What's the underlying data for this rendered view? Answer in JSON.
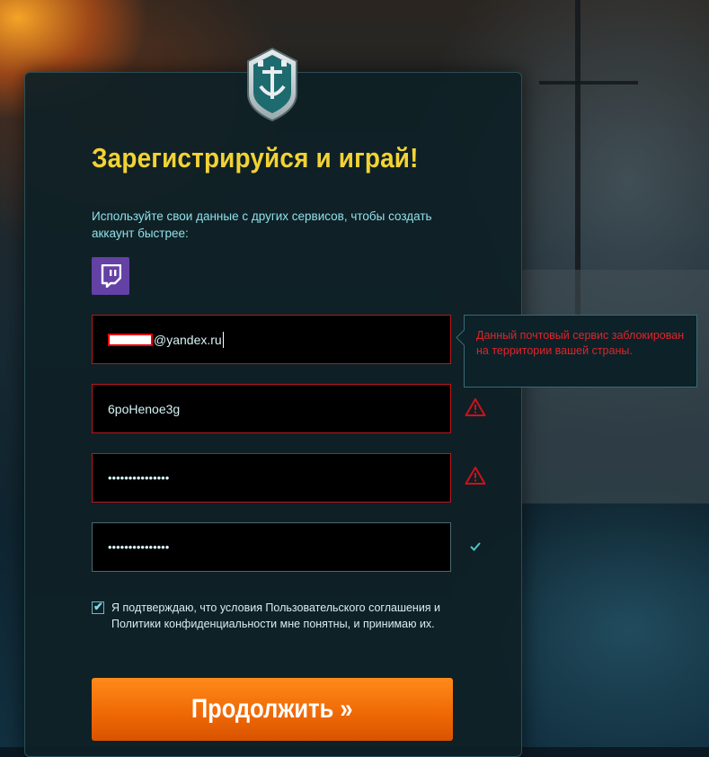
{
  "header": {
    "title": "Зарегистрируйся и играй!",
    "social_hint": "Используйте свои данные с других сервисов, чтобы создать аккаунт быстрее:"
  },
  "social": [
    {
      "name": "twitch",
      "icon": "twitch-icon",
      "color": "#6441a5"
    }
  ],
  "form": {
    "email": {
      "value_suffix": "@yandex.ru",
      "state": "error"
    },
    "nickname": {
      "value": "6poHenoe3g",
      "state": "warning"
    },
    "password": {
      "value": "•••••••••••••••",
      "state": "warning"
    },
    "password_confirm": {
      "value": "•••••••••••••••",
      "state": "ok"
    }
  },
  "email_error_tooltip": "Данный почтовый сервис заблокирован на территории вашей страны.",
  "agreement": {
    "checked": true,
    "text": "Я подтверждаю, что условия Пользовательского соглашения и Политики конфиденциальности мне понятны, и принимаю их."
  },
  "submit": {
    "label": "Продолжить »"
  },
  "colors": {
    "accent_title": "#f2d334",
    "hint_text": "#8fe0ea",
    "error": "#e0242a",
    "button": "#f06a06"
  },
  "icons": {
    "logo": "world-of-warships-emblem-icon",
    "warning": "warning-triangle-icon",
    "ok": "check-icon"
  }
}
